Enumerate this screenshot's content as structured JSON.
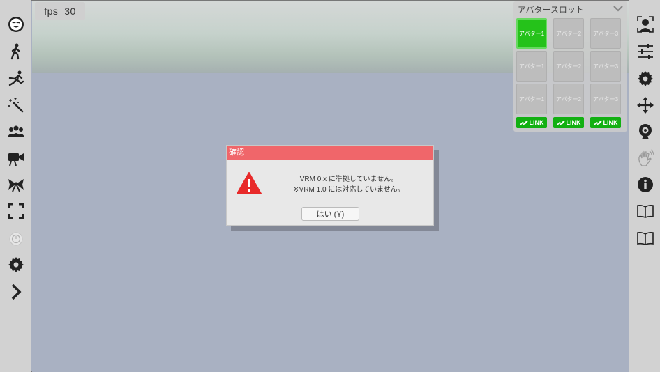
{
  "fps": {
    "label": "fps",
    "value": "30"
  },
  "left_toolbar": [
    {
      "icon": "face-icon"
    },
    {
      "icon": "walk-icon"
    },
    {
      "icon": "run-icon"
    },
    {
      "icon": "magic-wand-icon"
    },
    {
      "icon": "group-icon"
    },
    {
      "icon": "video-camera-icon"
    },
    {
      "icon": "bow-icon"
    },
    {
      "icon": "fullscreen-icon"
    },
    {
      "icon": "timer-icon"
    },
    {
      "icon": "settings-gear-icon"
    },
    {
      "icon": "chevron-right-icon"
    }
  ],
  "right_toolbar": [
    {
      "icon": "face-tracking-icon"
    },
    {
      "icon": "sliders-icon"
    },
    {
      "icon": "gear-icon"
    },
    {
      "icon": "move-arrows-icon"
    },
    {
      "icon": "webcam-icon"
    },
    {
      "icon": "hand-wave-icon"
    },
    {
      "icon": "info-icon"
    },
    {
      "icon": "book-icon"
    },
    {
      "icon": "book-icon"
    }
  ],
  "avatar_slots": {
    "title": "アバタースロット",
    "rows": [
      [
        "アバター1",
        "アバター2",
        "アバター3"
      ],
      [
        "アバター1",
        "アバター2",
        "アバター3"
      ],
      [
        "アバター1",
        "アバター2",
        "アバター3"
      ]
    ],
    "active": "0-0",
    "link_label": "LINK"
  },
  "dialog": {
    "title": "確認",
    "message_line1": "VRM 0.x に準拠していません。",
    "message_line2": "※VRM 1.0 には対応していません。",
    "ok_label": "はい (Y)"
  },
  "colors": {
    "dialog_title_bar": "#f0666a",
    "active_slot": "#25c21a",
    "link_button": "#12b012",
    "warning": "#e82a2a"
  }
}
